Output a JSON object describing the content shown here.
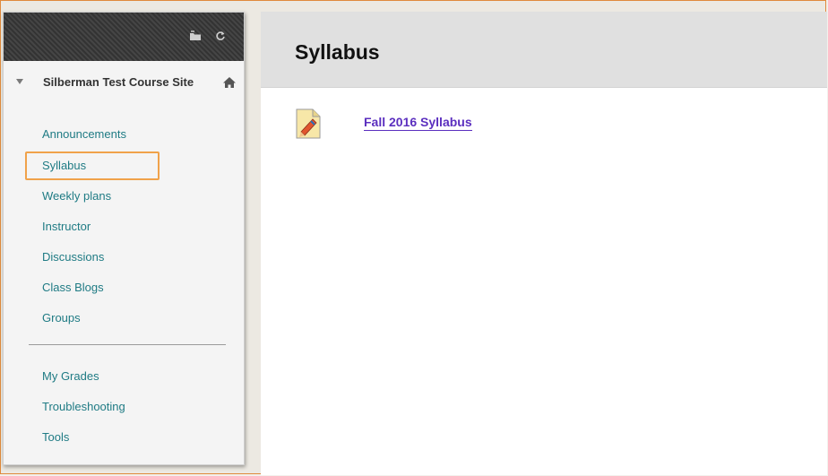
{
  "sidebar": {
    "course_title": "Silberman Test Course Site",
    "items": [
      {
        "label": "Announcements"
      },
      {
        "label": "Syllabus"
      },
      {
        "label": "Weekly plans"
      },
      {
        "label": "Instructor"
      },
      {
        "label": "Discussions"
      },
      {
        "label": "Class Blogs"
      },
      {
        "label": "Groups"
      }
    ],
    "secondary_items": [
      {
        "label": "My Grades"
      },
      {
        "label": "Troubleshooting"
      },
      {
        "label": "Tools"
      }
    ],
    "selected_item": "Syllabus",
    "top_icons": [
      "folder-icon",
      "refresh-icon"
    ],
    "home_icon": "home-icon"
  },
  "main": {
    "page_title": "Syllabus",
    "content_items": [
      {
        "label": "Fall 2016 Syllabus",
        "icon": "file-attachment-icon"
      }
    ]
  },
  "colors": {
    "link": "#1f7b84",
    "content_link": "#5b2fbf",
    "highlight": "#f0a24a",
    "frame_border": "#e08a3c"
  }
}
